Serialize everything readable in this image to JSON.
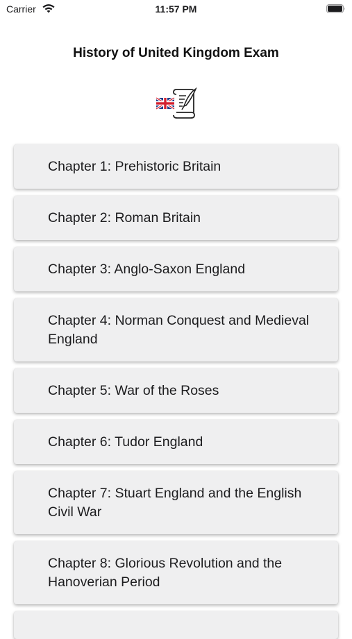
{
  "status_bar": {
    "carrier": "Carrier",
    "time": "11:57 PM"
  },
  "header": {
    "title": "History of United Kingdom Exam",
    "logo_icon": "uk-flag-scroll-icon"
  },
  "chapters": [
    {
      "label": "Chapter 1: Prehistoric Britain"
    },
    {
      "label": "Chapter 2: Roman Britain"
    },
    {
      "label": "Chapter 3: Anglo-Saxon England"
    },
    {
      "label": "Chapter 4: Norman Conquest and Medieval England"
    },
    {
      "label": "Chapter 5: War of the Roses"
    },
    {
      "label": "Chapter 6: Tudor England"
    },
    {
      "label": "Chapter 7: Stuart England and the English Civil War"
    },
    {
      "label": "Chapter 8: Glorious Revolution and the Hanoverian Period"
    },
    {
      "label": ""
    }
  ],
  "colors": {
    "card_background": "#efeff0",
    "text": "#1c1c1e",
    "background": "#ffffff"
  }
}
